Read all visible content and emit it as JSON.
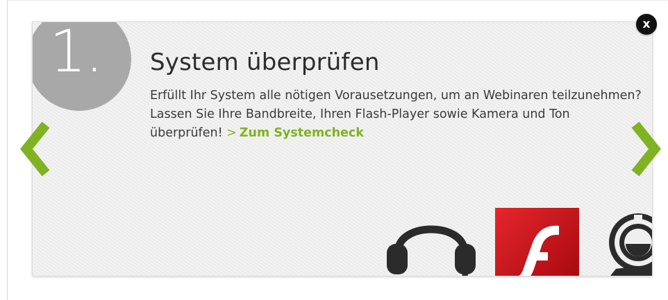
{
  "step": {
    "number": "1."
  },
  "title": "System überprüfen",
  "description": "Erfüllt Ihr System alle nötigen Vorausetzungen, um an Webinaren teilzunehmen? Lassen Sie Ihre Bandbreite, Ihren Flash-Player sowie Kamera und Ton überprüfen!",
  "link": {
    "chevron": ">",
    "label": "Zum Systemcheck"
  },
  "close": {
    "label": "x"
  },
  "nav": {
    "prev_icon": "chevron-left-icon",
    "next_icon": "chevron-right-icon"
  },
  "icons": [
    "headset-icon",
    "flash-player-icon",
    "webcam-icon"
  ],
  "colors": {
    "accent_green": "#7fb321",
    "step_circle": "#a8a8a8",
    "card_bg": "#efefef",
    "flash_red": "#c8161d"
  }
}
